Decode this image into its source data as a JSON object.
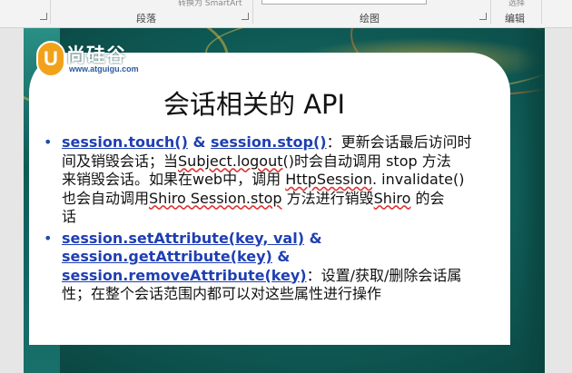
{
  "ribbon": {
    "paragraph_group": "段落",
    "drawing_group": "绘图",
    "editing_group": "编辑",
    "smartart_clip": "转换为 SmartArt",
    "select_clip": "选择"
  },
  "logo": {
    "badge": "U",
    "name": "尚硅谷",
    "url": "www.atguigu.com"
  },
  "slide": {
    "title": "会话相关的 API",
    "bullet1": {
      "kw1": "session.touch()",
      "amp": " & ",
      "kw2": "session.stop()",
      "l1_tail": "：更新会话最后访问时",
      "l2_a": "间及销毁会话；当",
      "l2_b": "Subject.logout",
      "l2_c": "()时会自动调用 stop 方法",
      "l3_a": "来销毁会话。如果在web中，调用 ",
      "l3_b": "HttpSession",
      "l3_c": ". invalidate()",
      "l4_a": "也会自动调用",
      "l4_b": "Shiro Session.stop",
      "l4_c": " 方法进行销毁",
      "l4_d": "Shiro",
      "l4_e": " 的会",
      "l5": "话"
    },
    "bullet2": {
      "kw1": "session.setAttribute(key, val)",
      "amp1": " &",
      "kw2": "session.getAttribute(key)",
      "amp2": " &",
      "kw3": "session.removeAttribute(key)",
      "l3_tail": "：设置/获取/删除会话属",
      "l4": "性；在整个会话范围内都可以对这些属性进行操作"
    }
  }
}
